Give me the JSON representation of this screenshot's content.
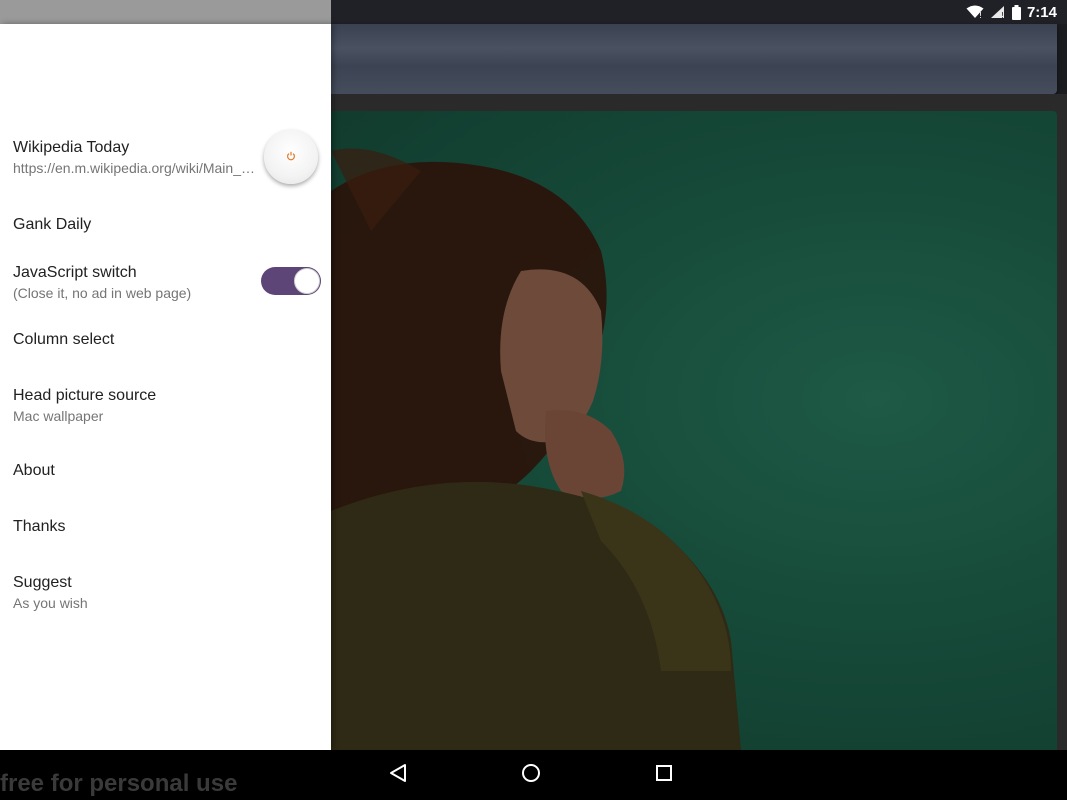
{
  "status_bar": {
    "time": "7:14",
    "icons": [
      "wifi-icon",
      "signal-icon",
      "battery-icon"
    ]
  },
  "drawer": {
    "items": [
      {
        "title": "Wikipedia Today",
        "subtitle": "https://en.m.wikipedia.org/wiki/Main_Page",
        "control": "power-icon"
      },
      {
        "title": "Gank Daily"
      },
      {
        "title": "JavaScript switch",
        "subtitle": "(Close it, no ad in web page)",
        "toggle_on": true
      },
      {
        "title": "Column select"
      },
      {
        "title": "Head picture source",
        "subtitle": "Mac wallpaper"
      },
      {
        "title": "About"
      },
      {
        "title": "Thanks"
      },
      {
        "title": "Suggest",
        "subtitle": "As you wish"
      }
    ]
  },
  "watermark": "free for personal use",
  "nav_bar": {
    "buttons": [
      "back-icon",
      "home-icon",
      "recents-icon"
    ]
  },
  "colors": {
    "toggle_track": "#5e4577",
    "power_accent": "#e07b2a",
    "background_card": "#164a39"
  }
}
